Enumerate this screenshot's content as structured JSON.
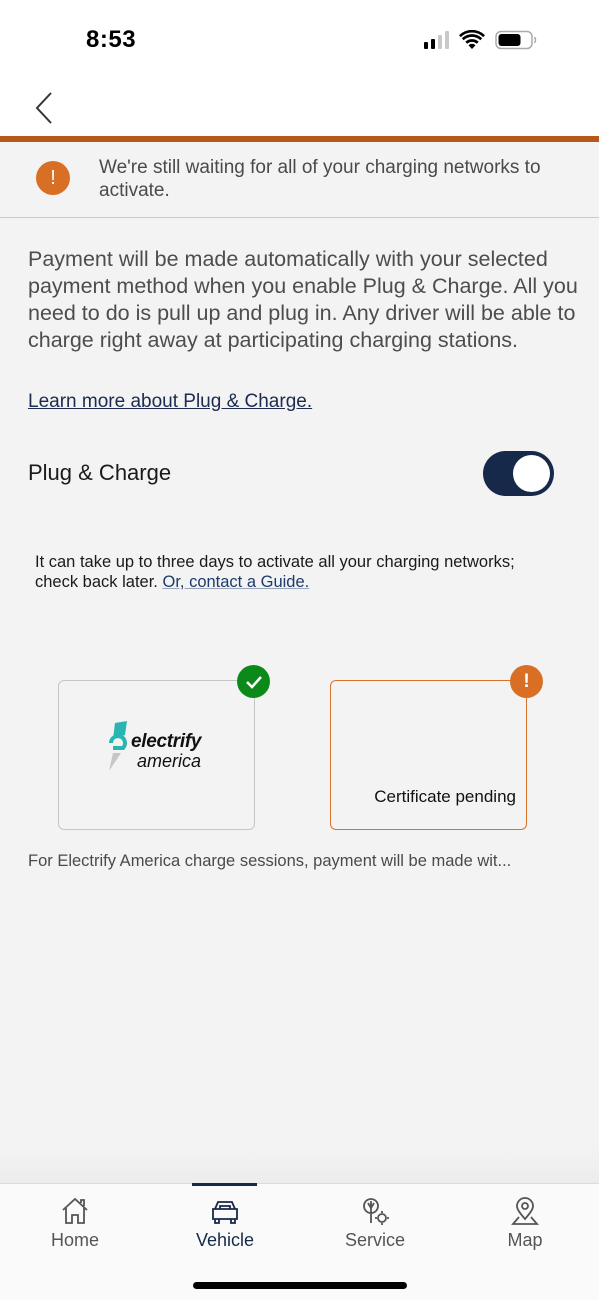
{
  "status_bar": {
    "time": "8:53",
    "signal_bars_active": 2,
    "signal_bars_total": 4
  },
  "nav": {
    "back_label": "Back"
  },
  "banner": {
    "icon": "exclamation-icon",
    "icon_glyph": "!",
    "text": "We're still waiting for all of your charging networks to activate.",
    "accent_color": "#b5581a",
    "icon_color": "#d86f24"
  },
  "main": {
    "description": "Payment will be made automatically with your selected payment method when you enable Plug & Charge. All you need to do is pull up and plug in. Any driver will be able to charge right away at participating charging stations.",
    "learn_more_link": "Learn more about Plug & Charge.",
    "plug_charge": {
      "label": "Plug & Charge",
      "enabled": true,
      "toggle_color": "#17294a"
    },
    "info_text": "It can take up to three days to activate all your charging networks; check back later. ",
    "guide_link": "Or, contact a Guide.",
    "networks": [
      {
        "name": "Electrify America",
        "logo_line1": "electrify",
        "logo_line2": "america",
        "status": "active",
        "badge_icon": "check-icon",
        "badge_color": "#0b8a19"
      },
      {
        "name": "",
        "status_text": "Certificate pending",
        "status": "pending",
        "badge_icon": "exclamation-icon",
        "badge_glyph": "!",
        "badge_color": "#d86f24"
      }
    ],
    "footnote": "For Electrify America charge sessions, payment will be made wit..."
  },
  "tabbar": {
    "tabs": [
      {
        "label": "Home",
        "icon": "home-icon",
        "active": false
      },
      {
        "label": "Vehicle",
        "icon": "car-icon",
        "active": true
      },
      {
        "label": "Service",
        "icon": "service-icon",
        "active": false
      },
      {
        "label": "Map",
        "icon": "map-pin-icon",
        "active": false
      }
    ]
  }
}
